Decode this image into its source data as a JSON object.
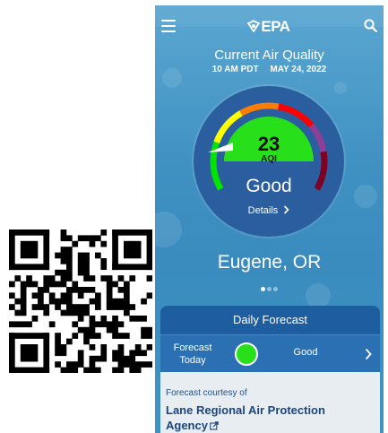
{
  "app": {
    "logo_text": "EPA",
    "icons": [
      "menu-icon",
      "search-icon",
      "epa-logo-mark"
    ]
  },
  "current": {
    "title": "Current Air Quality",
    "time": "10 AM PDT",
    "date": "MAY 24, 2022",
    "aqi_value": "23",
    "aqi_label": "AQI",
    "category": "Good",
    "details_label": "Details"
  },
  "location": {
    "city": "Eugene, OR",
    "page_count": 3,
    "active_page": 1
  },
  "forecast": {
    "header": "Daily Forecast",
    "day_label": "Forecast Today",
    "day_line1": "Forecast",
    "day_line2": "Today",
    "level": "Good",
    "level_color": "#28e01a",
    "courtesy_label": "Forecast courtesy of",
    "agency": "Lane Regional Air Protection Agency"
  },
  "colors": {
    "good": "#00e400",
    "moderate": "#ffff00",
    "usg": "#ff7e00",
    "unhealthy": "#ff0000",
    "very_unhealthy": "#8f3f97",
    "hazardous": "#7e0023",
    "gauge_bg": "#2a5e9f"
  }
}
